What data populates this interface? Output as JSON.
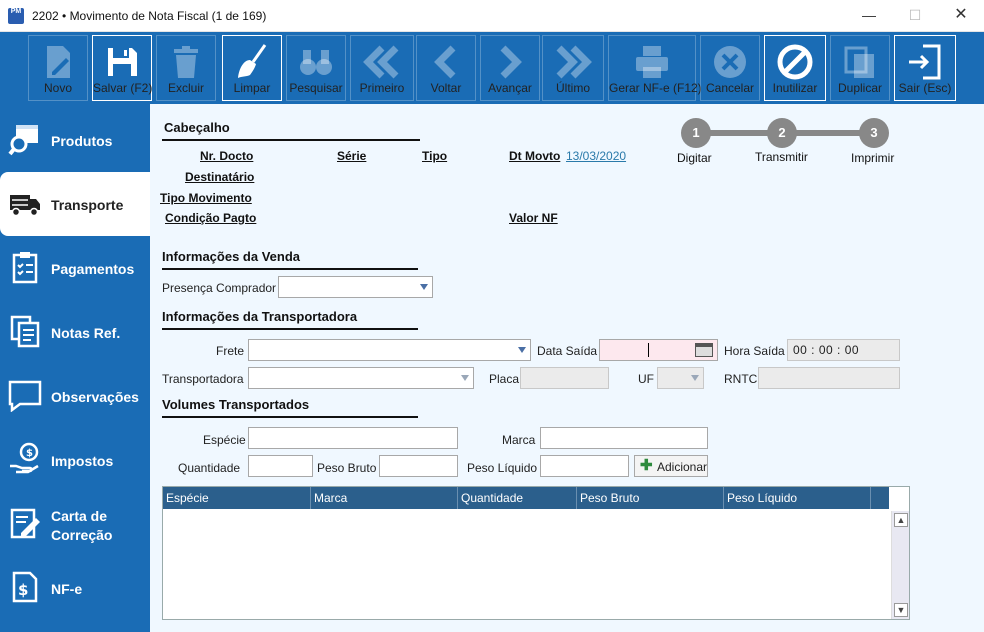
{
  "window": {
    "app_icon_text": "PM",
    "title": "2202 • Movimento de Nota Fiscal (1 de 169)",
    "minimize": "—",
    "maximize": "☐",
    "close": "✕"
  },
  "toolbar": {
    "novo": "Novo",
    "salvar": "Salvar (F2)",
    "excluir": "Excluir",
    "limpar": "Limpar",
    "pesquisar": "Pesquisar",
    "primeiro": "Primeiro",
    "voltar": "Voltar",
    "avancar": "Avançar",
    "ultimo": "Último",
    "gerar_nfe": "Gerar NF-e (F12)",
    "cancelar": "Cancelar",
    "inutilizar": "Inutilizar",
    "duplicar": "Duplicar",
    "sair": "Sair (Esc)"
  },
  "sidebar": {
    "items": [
      {
        "label": "Produtos",
        "icon": "box-search-icon"
      },
      {
        "label": "Transporte",
        "icon": "truck-icon"
      },
      {
        "label": "Pagamentos",
        "icon": "clipboard-list-icon"
      },
      {
        "label": "Notas Ref.",
        "icon": "documents-icon"
      },
      {
        "label": "Observações",
        "icon": "speech-bubble-icon"
      },
      {
        "label": "Impostos",
        "icon": "hand-coin-icon"
      },
      {
        "label": "Carta de",
        "label2": "Correção",
        "icon": "edit-document-icon"
      },
      {
        "label": "NF-e",
        "icon": "money-document-icon"
      }
    ]
  },
  "header": {
    "section_title": "Cabeçalho",
    "nr_docto": "Nr. Docto",
    "serie": "Série",
    "tipo": "Tipo",
    "dt_movto_label": "Dt Movto",
    "dt_movto_value": "13/03/2020",
    "destinatario": "Destinatário",
    "tipo_movimento": "Tipo Movimento",
    "condicao_pagto": "Condição Pagto",
    "valor_nf": "Valor NF"
  },
  "steps": [
    {
      "num": "1",
      "label": "Digitar"
    },
    {
      "num": "2",
      "label": "Transmitir"
    },
    {
      "num": "3",
      "label": "Imprimir"
    }
  ],
  "venda": {
    "section_title": "Informações da Venda",
    "presenca_label": "Presença Comprador",
    "presenca_value": ""
  },
  "transportadora": {
    "section_title": "Informações da Transportadora",
    "frete_label": "Frete",
    "data_saida_label": "Data Saída",
    "hora_saida_label": "Hora Saída",
    "hora_saida_value": "00 : 00 : 00",
    "transportadora_label": "Transportadora",
    "placa_label": "Placa",
    "uf_label": "UF",
    "rntc_label": "RNTC"
  },
  "volumes": {
    "section_title": "Volumes Transportados",
    "especie_label": "Espécie",
    "marca_label": "Marca",
    "quantidade_label": "Quantidade",
    "peso_bruto_label": "Peso Bruto",
    "peso_liquido_label": "Peso Líquido",
    "adicionar": "Adicionar",
    "columns": [
      "Espécie",
      "Marca",
      "Quantidade",
      "Peso Bruto",
      "Peso Líquido"
    ]
  },
  "colors": {
    "primary": "#1a6cb5",
    "main_bg": "#f0f8ff",
    "grid_header": "#2b5f8c"
  }
}
